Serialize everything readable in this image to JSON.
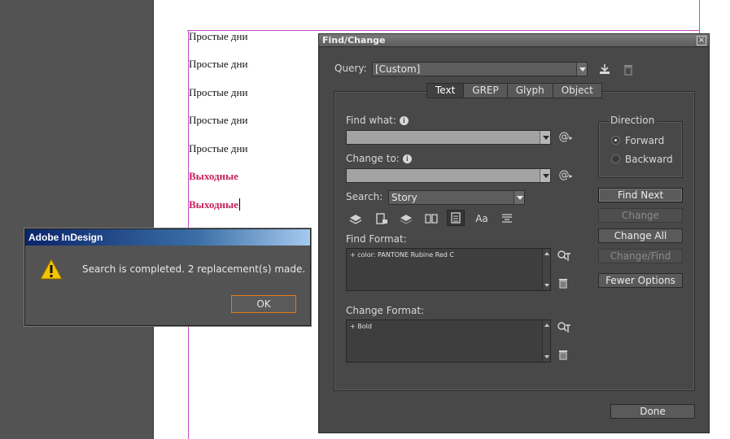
{
  "document": {
    "lines": [
      "Простые дни",
      "Простые дни",
      "Простые дни",
      "Простые дни",
      "Простые дни"
    ],
    "styled_lines": [
      "Выходные",
      "Выходные"
    ],
    "styled_color": "#c8205a"
  },
  "alert": {
    "title": "Adobe InDesign",
    "message": "Search is completed.  2 replacement(s) made.",
    "ok_label": "OK"
  },
  "find_change": {
    "title": "Find/Change",
    "close_glyph": "×",
    "query_label": "Query:",
    "query_value": "[Custom]",
    "tabs": [
      "Text",
      "GREP",
      "Glyph",
      "Object"
    ],
    "active_tab": "Text",
    "find_what_label": "Find what:",
    "find_what_value": "",
    "change_to_label": "Change to:",
    "change_to_value": "",
    "search_label": "Search:",
    "search_value": "Story",
    "direction": {
      "legend": "Direction",
      "options": [
        "Forward",
        "Backward"
      ],
      "selected": "Forward"
    },
    "find_format_label": "Find Format:",
    "find_format_value": "+ color: PANTONE Rubine Red C",
    "change_format_label": "Change Format:",
    "change_format_value": "+ Bold",
    "buttons": {
      "find_next": "Find Next",
      "change": "Change",
      "change_all": "Change All",
      "change_find": "Change/Find",
      "fewer_options": "Fewer Options",
      "done": "Done"
    },
    "option_case_sensitive": "Aa"
  }
}
